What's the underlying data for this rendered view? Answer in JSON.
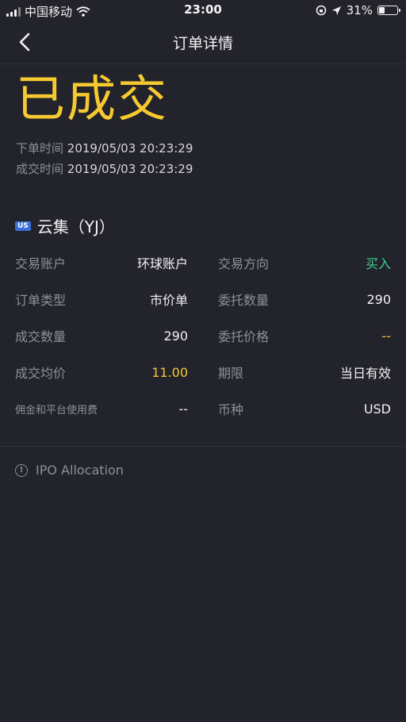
{
  "status_bar": {
    "carrier": "中国移动",
    "time": "23:00",
    "battery": "31%",
    "battery_level": 0.31
  },
  "nav": {
    "title": "订单详情",
    "back_icon": "chevron-left-icon"
  },
  "order": {
    "status": "已成交",
    "order_time_label": "下单时间",
    "order_time": "2019/05/03 20:23:29",
    "fill_time_label": "成交时间",
    "fill_time": "2019/05/03 20:23:29"
  },
  "stock": {
    "market": "US",
    "name": "云集（YJ）"
  },
  "details": [
    {
      "left_label": "交易账户",
      "left_value": "环球账户",
      "right_label": "交易方向",
      "right_value": "买入"
    },
    {
      "left_label": "订单类型",
      "left_value": "市价单",
      "right_label": "委托数量",
      "right_value": "290"
    },
    {
      "left_label": "成交数量",
      "left_value": "290",
      "right_label": "委托价格",
      "right_value": "--"
    },
    {
      "left_label": "成交均价",
      "left_value": "11.00",
      "right_label": "期限",
      "right_value": "当日有效"
    },
    {
      "left_label": "佣金和平台使用费",
      "left_value": "--",
      "right_label": "币种",
      "right_value": "USD"
    }
  ],
  "colors": {
    "background": "#22232b",
    "status_yellow": "#f6c930",
    "buy_green": "#3fd08a",
    "label_gray": "#8e8f99"
  },
  "footer": {
    "ipo_text": "IPO Allocation"
  }
}
